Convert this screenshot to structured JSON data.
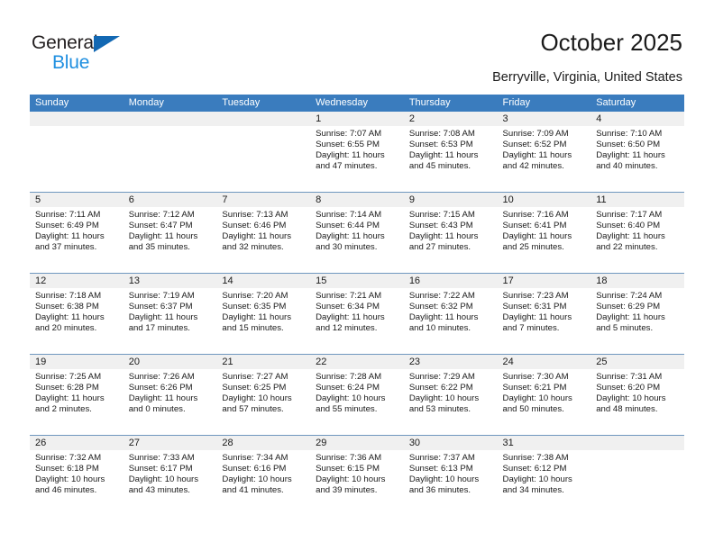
{
  "brand": {
    "name_top": "General",
    "name_bottom": "Blue",
    "accent_color": "#1268b3",
    "accent_color_light": "#1f8fe0"
  },
  "header": {
    "title": "October 2025",
    "subtitle": "Berryville, Virginia, United States"
  },
  "theme": {
    "header_row_bg": "#3a7cbe",
    "day_band_bg": "#f0f0f0",
    "row_divider": "#6f97bf",
    "text": "#1a1a1a"
  },
  "weekdays": [
    "Sunday",
    "Monday",
    "Tuesday",
    "Wednesday",
    "Thursday",
    "Friday",
    "Saturday"
  ],
  "labels": {
    "sunrise_prefix": "Sunrise:",
    "sunset_prefix": "Sunset:",
    "daylight_prefix": "Daylight:"
  },
  "weeks": [
    [
      {
        "day": "",
        "sunrise": "",
        "sunset": "",
        "daylight": ""
      },
      {
        "day": "",
        "sunrise": "",
        "sunset": "",
        "daylight": ""
      },
      {
        "day": "",
        "sunrise": "",
        "sunset": "",
        "daylight": ""
      },
      {
        "day": "1",
        "sunrise": "Sunrise: 7:07 AM",
        "sunset": "Sunset: 6:55 PM",
        "daylight": "Daylight: 11 hours and 47 minutes."
      },
      {
        "day": "2",
        "sunrise": "Sunrise: 7:08 AM",
        "sunset": "Sunset: 6:53 PM",
        "daylight": "Daylight: 11 hours and 45 minutes."
      },
      {
        "day": "3",
        "sunrise": "Sunrise: 7:09 AM",
        "sunset": "Sunset: 6:52 PM",
        "daylight": "Daylight: 11 hours and 42 minutes."
      },
      {
        "day": "4",
        "sunrise": "Sunrise: 7:10 AM",
        "sunset": "Sunset: 6:50 PM",
        "daylight": "Daylight: 11 hours and 40 minutes."
      }
    ],
    [
      {
        "day": "5",
        "sunrise": "Sunrise: 7:11 AM",
        "sunset": "Sunset: 6:49 PM",
        "daylight": "Daylight: 11 hours and 37 minutes."
      },
      {
        "day": "6",
        "sunrise": "Sunrise: 7:12 AM",
        "sunset": "Sunset: 6:47 PM",
        "daylight": "Daylight: 11 hours and 35 minutes."
      },
      {
        "day": "7",
        "sunrise": "Sunrise: 7:13 AM",
        "sunset": "Sunset: 6:46 PM",
        "daylight": "Daylight: 11 hours and 32 minutes."
      },
      {
        "day": "8",
        "sunrise": "Sunrise: 7:14 AM",
        "sunset": "Sunset: 6:44 PM",
        "daylight": "Daylight: 11 hours and 30 minutes."
      },
      {
        "day": "9",
        "sunrise": "Sunrise: 7:15 AM",
        "sunset": "Sunset: 6:43 PM",
        "daylight": "Daylight: 11 hours and 27 minutes."
      },
      {
        "day": "10",
        "sunrise": "Sunrise: 7:16 AM",
        "sunset": "Sunset: 6:41 PM",
        "daylight": "Daylight: 11 hours and 25 minutes."
      },
      {
        "day": "11",
        "sunrise": "Sunrise: 7:17 AM",
        "sunset": "Sunset: 6:40 PM",
        "daylight": "Daylight: 11 hours and 22 minutes."
      }
    ],
    [
      {
        "day": "12",
        "sunrise": "Sunrise: 7:18 AM",
        "sunset": "Sunset: 6:38 PM",
        "daylight": "Daylight: 11 hours and 20 minutes."
      },
      {
        "day": "13",
        "sunrise": "Sunrise: 7:19 AM",
        "sunset": "Sunset: 6:37 PM",
        "daylight": "Daylight: 11 hours and 17 minutes."
      },
      {
        "day": "14",
        "sunrise": "Sunrise: 7:20 AM",
        "sunset": "Sunset: 6:35 PM",
        "daylight": "Daylight: 11 hours and 15 minutes."
      },
      {
        "day": "15",
        "sunrise": "Sunrise: 7:21 AM",
        "sunset": "Sunset: 6:34 PM",
        "daylight": "Daylight: 11 hours and 12 minutes."
      },
      {
        "day": "16",
        "sunrise": "Sunrise: 7:22 AM",
        "sunset": "Sunset: 6:32 PM",
        "daylight": "Daylight: 11 hours and 10 minutes."
      },
      {
        "day": "17",
        "sunrise": "Sunrise: 7:23 AM",
        "sunset": "Sunset: 6:31 PM",
        "daylight": "Daylight: 11 hours and 7 minutes."
      },
      {
        "day": "18",
        "sunrise": "Sunrise: 7:24 AM",
        "sunset": "Sunset: 6:29 PM",
        "daylight": "Daylight: 11 hours and 5 minutes."
      }
    ],
    [
      {
        "day": "19",
        "sunrise": "Sunrise: 7:25 AM",
        "sunset": "Sunset: 6:28 PM",
        "daylight": "Daylight: 11 hours and 2 minutes."
      },
      {
        "day": "20",
        "sunrise": "Sunrise: 7:26 AM",
        "sunset": "Sunset: 6:26 PM",
        "daylight": "Daylight: 11 hours and 0 minutes."
      },
      {
        "day": "21",
        "sunrise": "Sunrise: 7:27 AM",
        "sunset": "Sunset: 6:25 PM",
        "daylight": "Daylight: 10 hours and 57 minutes."
      },
      {
        "day": "22",
        "sunrise": "Sunrise: 7:28 AM",
        "sunset": "Sunset: 6:24 PM",
        "daylight": "Daylight: 10 hours and 55 minutes."
      },
      {
        "day": "23",
        "sunrise": "Sunrise: 7:29 AM",
        "sunset": "Sunset: 6:22 PM",
        "daylight": "Daylight: 10 hours and 53 minutes."
      },
      {
        "day": "24",
        "sunrise": "Sunrise: 7:30 AM",
        "sunset": "Sunset: 6:21 PM",
        "daylight": "Daylight: 10 hours and 50 minutes."
      },
      {
        "day": "25",
        "sunrise": "Sunrise: 7:31 AM",
        "sunset": "Sunset: 6:20 PM",
        "daylight": "Daylight: 10 hours and 48 minutes."
      }
    ],
    [
      {
        "day": "26",
        "sunrise": "Sunrise: 7:32 AM",
        "sunset": "Sunset: 6:18 PM",
        "daylight": "Daylight: 10 hours and 46 minutes."
      },
      {
        "day": "27",
        "sunrise": "Sunrise: 7:33 AM",
        "sunset": "Sunset: 6:17 PM",
        "daylight": "Daylight: 10 hours and 43 minutes."
      },
      {
        "day": "28",
        "sunrise": "Sunrise: 7:34 AM",
        "sunset": "Sunset: 6:16 PM",
        "daylight": "Daylight: 10 hours and 41 minutes."
      },
      {
        "day": "29",
        "sunrise": "Sunrise: 7:36 AM",
        "sunset": "Sunset: 6:15 PM",
        "daylight": "Daylight: 10 hours and 39 minutes."
      },
      {
        "day": "30",
        "sunrise": "Sunrise: 7:37 AM",
        "sunset": "Sunset: 6:13 PM",
        "daylight": "Daylight: 10 hours and 36 minutes."
      },
      {
        "day": "31",
        "sunrise": "Sunrise: 7:38 AM",
        "sunset": "Sunset: 6:12 PM",
        "daylight": "Daylight: 10 hours and 34 minutes."
      },
      {
        "day": "",
        "sunrise": "",
        "sunset": "",
        "daylight": ""
      }
    ]
  ]
}
